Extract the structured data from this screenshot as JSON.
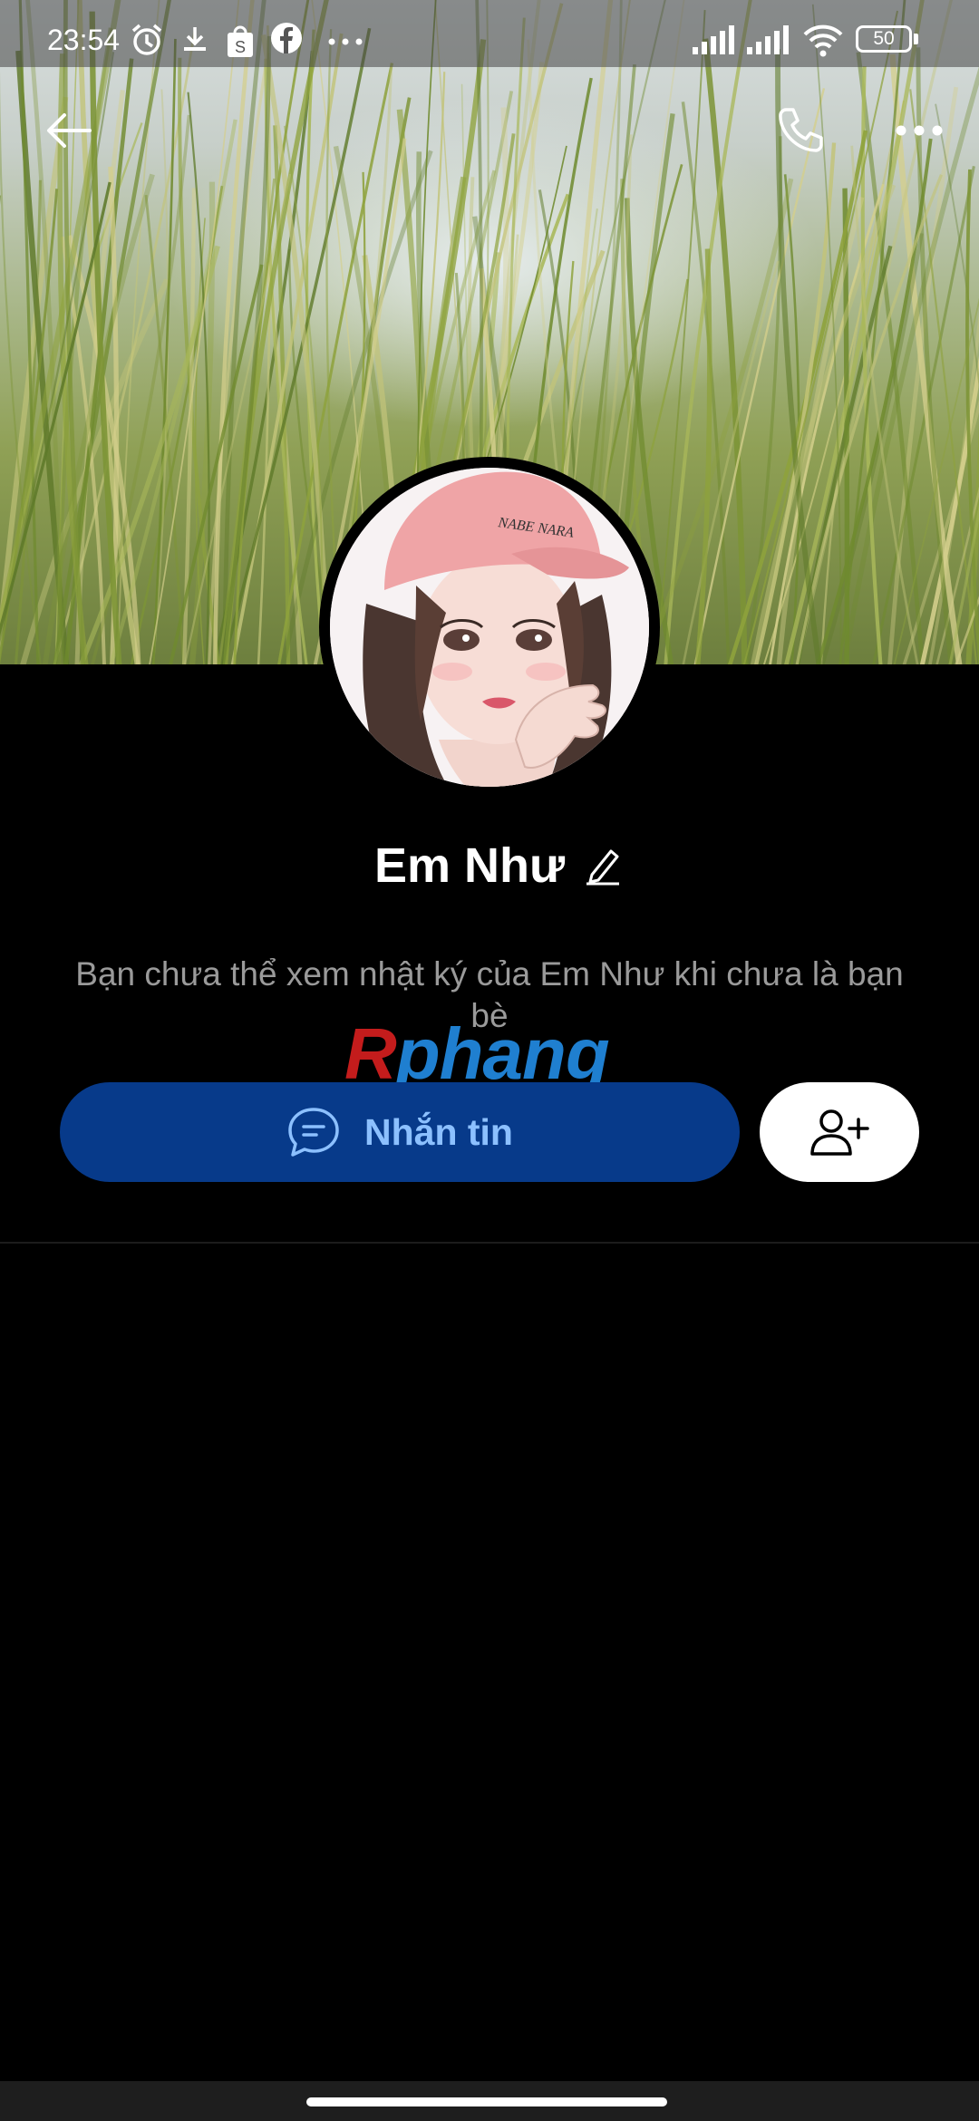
{
  "status_bar": {
    "time": "23:54",
    "battery": "50",
    "icons": [
      "alarm-icon",
      "download-icon",
      "shopping-bag-icon",
      "facebook-icon",
      "more-dots-icon",
      "signal-icon",
      "signal-icon",
      "wifi-icon",
      "battery-icon"
    ]
  },
  "top_bar": {
    "icons": [
      "back-arrow-icon",
      "phone-icon",
      "more-options-icon"
    ]
  },
  "cover": {
    "image": "grass-cover-photo"
  },
  "avatar": {
    "image": "anime-girl-pink-cap-avatar",
    "cap_text": "NABE NARA"
  },
  "profile": {
    "name": "Em Như",
    "edit_icon": "pencil-icon",
    "notice": "Bạn chưa thể xem nhật ký của Em Như khi chưa là bạn bè"
  },
  "watermark": {
    "first": "R",
    "rest": "phang"
  },
  "actions": {
    "message_label": "Nhắn tin",
    "message_icon": "chat-bubble-icon",
    "add_friend_icon": "add-friend-icon"
  },
  "colors": {
    "message_button_bg": "#073a8a",
    "message_button_text": "#8cc0ff",
    "background": "#000000"
  }
}
